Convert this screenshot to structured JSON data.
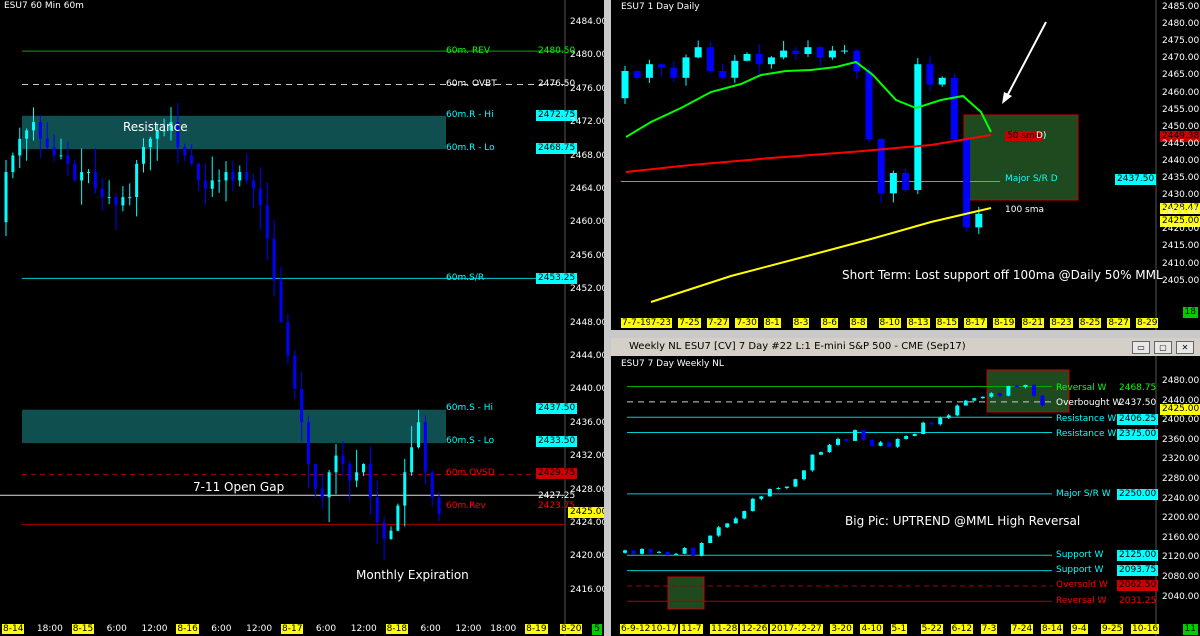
{
  "colors": {
    "candle_up": "#00ffff",
    "candle_down": "#0000ff",
    "sma_green": "#00ff00",
    "sma_red": "#ff0000",
    "sma_yellow": "#ffff00",
    "line_cyan": "#00cccc",
    "line_red": "#cc0000",
    "zone_teal": "#0f4f4f",
    "zone_green": "#1f4a1f"
  },
  "left": {
    "title": "ESU7 60 Min  60m",
    "y_ticks": [
      "2484.00",
      "2480.00",
      "2476.00",
      "2472.00",
      "2468.00",
      "2464.00",
      "2460.00",
      "2456.00",
      "2452.00",
      "2448.00",
      "2444.00",
      "2440.00",
      "2436.00",
      "2432.00",
      "2428.00",
      "2424.00",
      "2420.00",
      "2416.00"
    ],
    "levels": {
      "rev_label": "60m. REV",
      "rev_price": "2480.50",
      "ovbt_label": "60m. OVBT",
      "ovbt_price": "2476.50",
      "rhi_label": "60m.R - Hi",
      "rhi_price": "2472.75",
      "rlo_label": "60m.R - Lo",
      "rlo_price": "2468.75",
      "sr_label": "60m.S/R",
      "sr_price": "2453.25",
      "shi_label": "60m.S - Hi",
      "shi_price": "2437.50",
      "slo_label": "60m.S - Lo",
      "slo_price": "2433.50",
      "ovsd_label": "60m.OVSD",
      "ovsd_price": "2429.75",
      "srev_label": "60m.Rev",
      "srev_price": "2423.75",
      "gap_price": "2427.25",
      "last_price": "2425.00"
    },
    "notes": {
      "resistance": "Resistance",
      "gap": "7-11 Open Gap",
      "expiration": "Monthly Expiration"
    },
    "x_ticks": [
      "8-14",
      "18:00",
      "8-15",
      "6:00",
      "12:00",
      "8-16",
      "6:00",
      "12:00",
      "8-17",
      "6:00",
      "12:00",
      "8-18",
      "6:00",
      "12:00",
      "18:00",
      "8-19",
      "8-20"
    ],
    "corner": "5"
  },
  "top_right": {
    "title": "ESU7 1 Day  Daily",
    "y_ticks": [
      "2485.00",
      "2480.00",
      "2475.00",
      "2470.00",
      "2465.00",
      "2460.00",
      "2455.00",
      "2450.00",
      "2445.00",
      "2440.00",
      "2435.00",
      "2430.00",
      "2425.00",
      "2420.00",
      "2415.00",
      "2410.00",
      "2405.00"
    ],
    "labels": {
      "sma50": "50 sma",
      "d": "D)",
      "sma50_price": "2449.38",
      "sr": "Major S/R D",
      "sr_price": "2437.50",
      "sma100": "100 sma",
      "sma100_price": "2428.47",
      "last_price": "2425.00"
    },
    "note": "Short Term: Lost support off 100ma @Daily 50% MML",
    "x_ticks": [
      "7-7-19",
      "7-23",
      "7-25",
      "7-27",
      "7-30",
      "8-1",
      "8-3",
      "8-6",
      "8-8",
      "8-10",
      "8-13",
      "8-15",
      "8-17",
      "8-19",
      "8-21",
      "8-23",
      "8-25",
      "8-27",
      "8-29"
    ],
    "corner": "18"
  },
  "bottom_right": {
    "header": "Weekly NL  ESU7 [CV]  7 Day   #22  L:1  E-mini S&P 500 - CME (Sep17)",
    "title": "ESU7 7 Day  Weekly NL",
    "y_ticks": [
      "2480.00",
      "2440.00",
      "2400.00",
      "2360.00",
      "2320.00",
      "2280.00",
      "2240.00",
      "2200.00",
      "2160.00",
      "2120.00",
      "2080.00",
      "2040.00"
    ],
    "levels": {
      "rev_w": "Reversal W",
      "rev_w_price": "2468.75",
      "ob_w": "Overbought W",
      "ob_w_price": "2437.50",
      "res1": "Resistance W",
      "res1_price": "2406.25",
      "res2": "Resistance W",
      "res2_price": "2375.00",
      "msr": "Major S/R W",
      "msr_price": "2250.00",
      "sup1": "Support W",
      "sup1_price": "2125.00",
      "sup2": "Support W",
      "sup2_price": "2093.75",
      "os_w": "Oversold W",
      "os_w_price": "2062.50",
      "rev2": "Reversal W",
      "rev2_price": "2031.25",
      "last_price": "2425.00"
    },
    "note": "Big Pic: UPTREND @MML High Reversal",
    "x_ticks": [
      "6-9-12",
      "10-17",
      "11-7",
      "11-28",
      "12-26",
      "2017-1-30",
      "2-27",
      "3-20",
      "4-10",
      "5-1",
      "5-22",
      "6-12",
      "7-3",
      "7-24",
      "8-14",
      "9-4",
      "9-25",
      "10-16"
    ],
    "corner": "11",
    "buttons": [
      "▭",
      "▢",
      "✕"
    ]
  }
}
